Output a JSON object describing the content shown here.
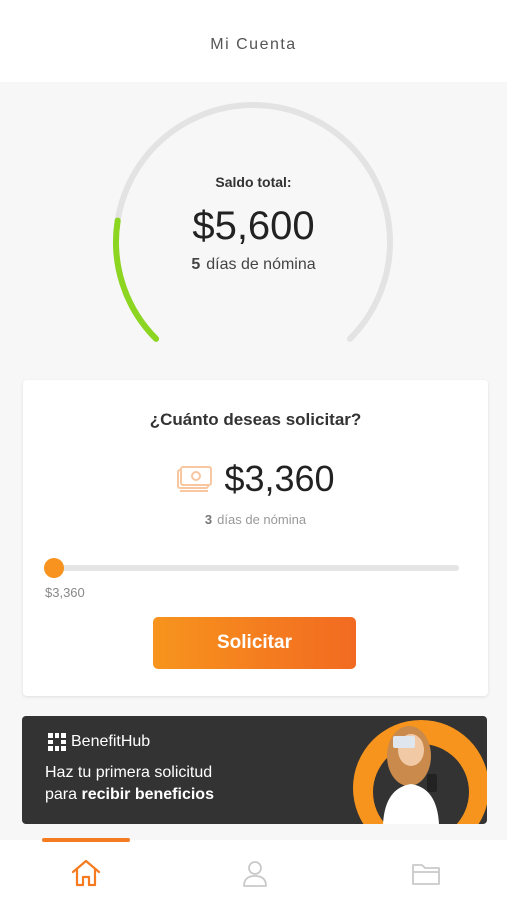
{
  "header": {
    "title": "Mi Cuenta"
  },
  "balance": {
    "label": "Saldo total:",
    "amount": "$5,600",
    "days_count": "5",
    "days_label": "días de nómina",
    "gauge_fraction": 0.2
  },
  "request": {
    "question": "¿Cuánto deseas solicitar?",
    "amount": "$3,360",
    "days_count": "3",
    "days_label": "días de nómina",
    "slider_min_label": "$3,360",
    "slider_position": 0.0,
    "button_label": "Solicitar"
  },
  "promo": {
    "brand": "BenefitHub",
    "line1": "Haz tu primera solicitud",
    "line2_prefix": "para ",
    "line2_bold": "recibir beneficios"
  },
  "nav": {
    "items": [
      {
        "icon": "home-icon",
        "active": true
      },
      {
        "icon": "user-icon",
        "active": false
      },
      {
        "icon": "folder-icon",
        "active": false
      }
    ]
  },
  "colors": {
    "accent": "#f47b20",
    "gauge_progress": "#8cd520",
    "gauge_track": "#e3e3e3",
    "banner_bg": "#333333"
  }
}
